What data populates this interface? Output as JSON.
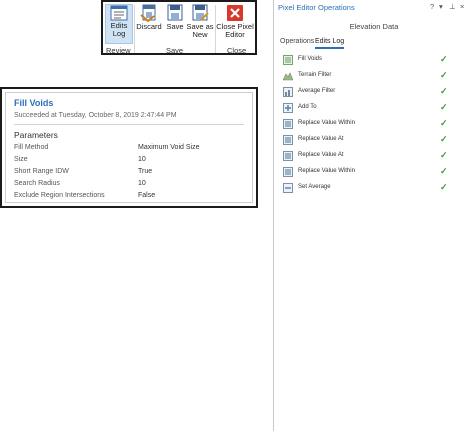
{
  "ribbon": {
    "buttons": {
      "edits_log": "Edits\nLog",
      "discard": "Discard",
      "save": "Save",
      "save_as_new": "Save as\nNew",
      "close_editor": "Close Pixel\nEditor"
    },
    "groups": {
      "review": "Review",
      "save": "Save",
      "close": "Close"
    }
  },
  "popup": {
    "title": "Fill Voids",
    "status": "Succeeded at Tuesday, October 8, 2019 2:47:44 PM",
    "params_heading": "Parameters",
    "params": [
      {
        "name": "Fill Method",
        "value": "Maximum Void Size"
      },
      {
        "name": "Size",
        "value": "10"
      },
      {
        "name": "Short Range IDW",
        "value": "True"
      },
      {
        "name": "Search Radius",
        "value": "10"
      },
      {
        "name": "Exclude Region Intersections",
        "value": "False"
      }
    ]
  },
  "pane": {
    "title": "Pixel Editor Operations",
    "controls": {
      "help": "?",
      "dropdown": "▾",
      "pin": "⊥",
      "close": "×"
    },
    "heading": "Elevation Data",
    "tabs": [
      {
        "label": "Operations",
        "active": false
      },
      {
        "label": "Edits Log",
        "active": true
      }
    ],
    "log_items": [
      {
        "label": "Fill Voids",
        "icon": "fill-voids-icon"
      },
      {
        "label": "Terrain Filter",
        "icon": "terrain-filter-icon"
      },
      {
        "label": "Average Filter",
        "icon": "average-filter-icon"
      },
      {
        "label": "Add To",
        "icon": "add-to-icon"
      },
      {
        "label": "Replace Value Within",
        "icon": "replace-value-icon"
      },
      {
        "label": "Replace Value At",
        "icon": "replace-value-icon"
      },
      {
        "label": "Replace Value At",
        "icon": "replace-value-icon"
      },
      {
        "label": "Replace Value Within",
        "icon": "replace-value-icon"
      },
      {
        "label": "Set Average",
        "icon": "set-average-icon"
      }
    ],
    "check_glyph": "✓"
  },
  "colors": {
    "accent": "#2c6fb7",
    "check": "#3a9b3a",
    "active_button": "#cfe3f5"
  }
}
